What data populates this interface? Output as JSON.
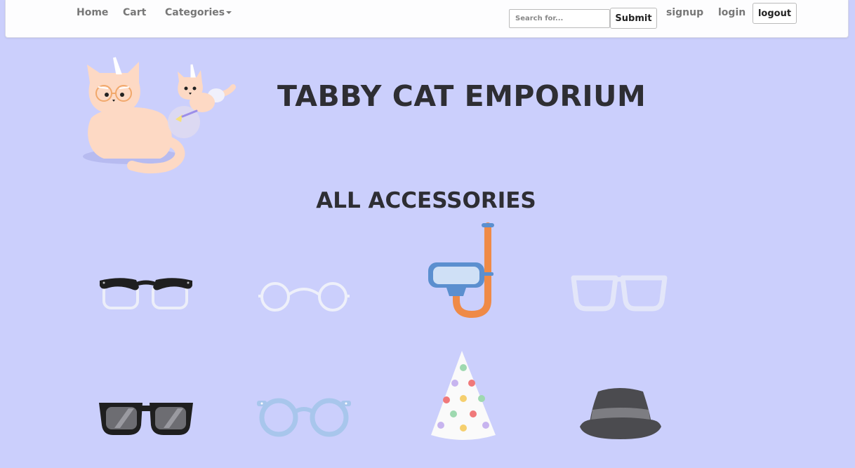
{
  "nav": {
    "home": "Home",
    "cart": "Cart",
    "categories": "Categories",
    "search_placeholder": "Search for...",
    "submit": "Submit",
    "signup": "signup",
    "login": "login",
    "logout": "logout"
  },
  "header": {
    "title": "TABBY CAT EMPORIUM"
  },
  "section": {
    "title": "ALL ACCESSORIES"
  },
  "products": [
    {
      "icon": "black-browline-glasses-icon"
    },
    {
      "icon": "round-wire-glasses-icon"
    },
    {
      "icon": "snorkel-mask-icon"
    },
    {
      "icon": "white-frame-glasses-icon"
    },
    {
      "icon": "sunglasses-icon"
    },
    {
      "icon": "blue-round-glasses-icon"
    },
    {
      "icon": "party-hat-icon"
    },
    {
      "icon": "fedora-hat-icon"
    }
  ],
  "colors": {
    "background": "#cbcffc",
    "navbar": "#fdfdfe",
    "title_text": "#2e2e33",
    "cat_fur": "#fdd9c4"
  }
}
